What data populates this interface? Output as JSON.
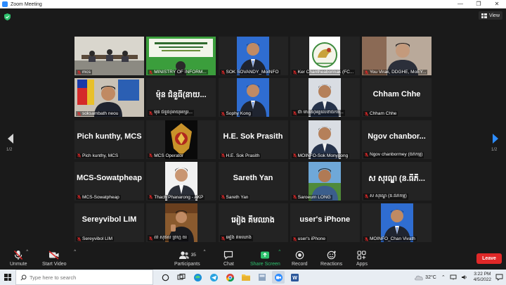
{
  "window": {
    "title": "Zoom Meeting"
  },
  "header": {
    "view_label": "View"
  },
  "pager": {
    "left_page": "1/2",
    "right_page": "1/2"
  },
  "tiles": [
    {
      "label": "mcs",
      "display_name": "",
      "kind": "photo-room"
    },
    {
      "label": "MINISTRY OF INFORM...",
      "display_name": "",
      "kind": "photo-slide"
    },
    {
      "label": "SOK SOVANDY_MoINFO",
      "display_name": "",
      "kind": "photo-portrait"
    },
    {
      "label": "Ker Chantheaborinak (FC...",
      "display_name": "",
      "kind": "photo-logo"
    },
    {
      "label": "You Virak, DDGHE, MoEY...",
      "display_name": "",
      "kind": "photo-man"
    },
    {
      "label": "soksambath neou",
      "display_name": "",
      "kind": "photo-flag"
    },
    {
      "label": "ម៉ុន ជំនួធី(អាយុអក្សរ...",
      "display_name": "ម៉ុន ជំនួធី(នាយ...",
      "kind": "name"
    },
    {
      "label": "Sophy Kong",
      "display_name": "",
      "kind": "photo-portrait"
    },
    {
      "label": "ជា ម៉ានិន(អគ្គលេខាធិការ...",
      "display_name": "",
      "kind": "photo-portrait2"
    },
    {
      "label": "Chham Chhe",
      "display_name": "Chham Chhe",
      "kind": "name"
    },
    {
      "label": "Pich kunthy, MCS",
      "display_name": "Pich kunthy, MCS",
      "kind": "name"
    },
    {
      "label": "MCS Operator",
      "display_name": "",
      "kind": "photo-emblem"
    },
    {
      "label": "H.E. Sok Prasith",
      "display_name": "H.E. Sok Prasith",
      "kind": "name"
    },
    {
      "label": "MOINFO-Sok Monypong",
      "display_name": "",
      "kind": "photo-portrait2"
    },
    {
      "label": "Ngov chanbormey (ធីភីកម្ម)",
      "display_name": "Ngov chanbor...",
      "kind": "name"
    },
    {
      "label": "MCS-Sowatpheap",
      "display_name": "MCS-Sowatpheap",
      "kind": "name"
    },
    {
      "label": "Thach Phanarong - AKP",
      "display_name": "",
      "kind": "photo-portrait3"
    },
    {
      "label": "Sareth Yan",
      "display_name": "Sareth Yan",
      "kind": "name"
    },
    {
      "label": "Saroeurn LONG",
      "display_name": "",
      "kind": "photo-outdoor"
    },
    {
      "label": "ស សុរណ្ឌ (ន.ធីភីកម្ម)",
      "display_name": "ស សុរណ្ឌ (ន.ធីភី...",
      "kind": "name"
    },
    {
      "label": "Sereyvibol LIM",
      "display_name": "Sereyvibol LIM",
      "kind": "name"
    },
    {
      "label": "លឺ សុំផល ព្រហ្ម ចរ",
      "display_name": "",
      "kind": "photo-speaker"
    },
    {
      "label": "អៀង គឹមឈាង",
      "display_name": "អៀង គឹមឈាង",
      "kind": "name"
    },
    {
      "label": "user's iPhone",
      "display_name": "user's iPhone",
      "kind": "name"
    },
    {
      "label": "MOINFO_Chan Vivath",
      "display_name": "",
      "kind": "photo-portrait"
    }
  ],
  "toolbar": {
    "unmute": "Unmute",
    "start_video": "Start Video",
    "participants": "Participants",
    "participants_count": "35",
    "chat": "Chat",
    "share_screen": "Share Screen",
    "record": "Record",
    "reactions": "Reactions",
    "apps": "Apps",
    "leave": "Leave"
  },
  "taskbar": {
    "search_placeholder": "Type here to search",
    "temperature": "32°C",
    "time": "3:22 PM",
    "date": "4/5/2022"
  },
  "colors": {
    "accent_blue": "#2d8cff",
    "leave_red": "#e02828",
    "share_green": "#2ec26e",
    "active_speaker": "#c4d845"
  }
}
